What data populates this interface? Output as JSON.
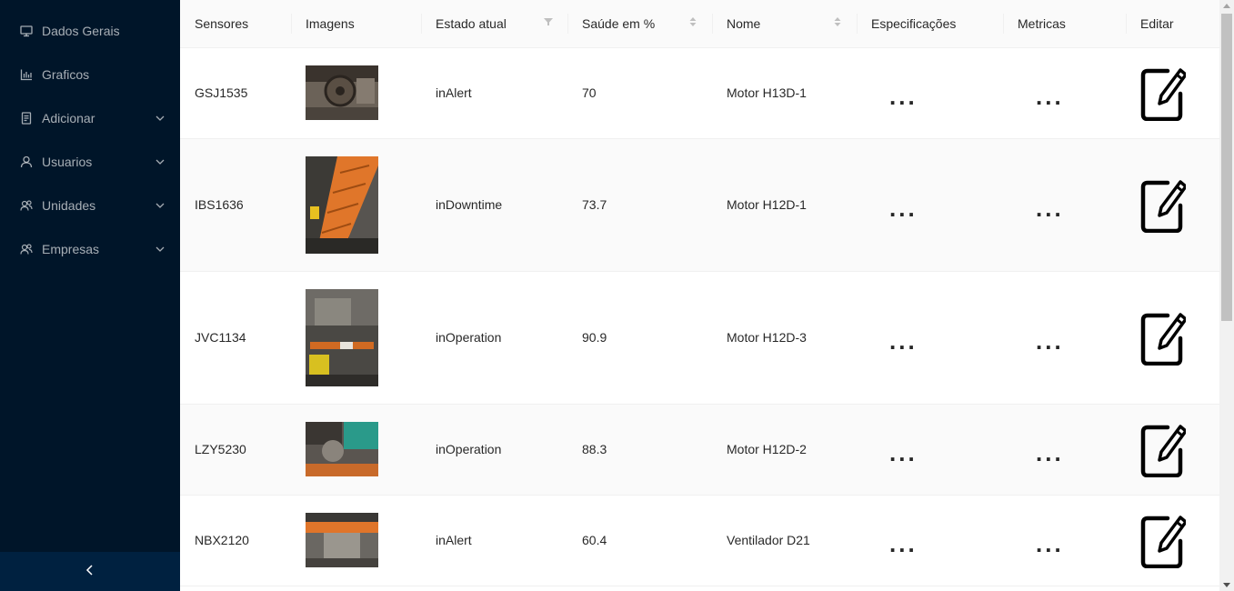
{
  "sidebar": {
    "items": [
      {
        "label": "Dados Gerais",
        "icon": "desktop-icon",
        "submenu": false
      },
      {
        "label": "Graficos",
        "icon": "bar-chart-icon",
        "submenu": false
      },
      {
        "label": "Adicionar",
        "icon": "file-icon",
        "submenu": true
      },
      {
        "label": "Usuarios",
        "icon": "user-icon",
        "submenu": true
      },
      {
        "label": "Unidades",
        "icon": "team-icon",
        "submenu": true
      },
      {
        "label": "Empresas",
        "icon": "team-icon",
        "submenu": true
      }
    ],
    "collapse_icon": "chevron-left-icon"
  },
  "table": {
    "columns": [
      "Sensores",
      "Imagens",
      "Estado atual",
      "Saúde em %",
      "Nome",
      "Especificações",
      "Metricas",
      "Editar"
    ],
    "more_label": "...",
    "rows": [
      {
        "sensor": "GSJ1535",
        "state": "inAlert",
        "health": "70",
        "name": "Motor H13D-1"
      },
      {
        "sensor": "IBS1636",
        "state": "inDowntime",
        "health": "73.7",
        "name": "Motor H12D-1"
      },
      {
        "sensor": "JVC1134",
        "state": "inOperation",
        "health": "90.9",
        "name": "Motor H12D-3"
      },
      {
        "sensor": "LZY5230",
        "state": "inOperation",
        "health": "88.3",
        "name": "Motor H12D-2"
      },
      {
        "sensor": "NBX2120",
        "state": "inAlert",
        "health": "60.4",
        "name": "Ventilador D21"
      }
    ]
  },
  "colors": {
    "sidebar_bg": "#001529",
    "sidebar_footer_bg": "#002140",
    "header_bg": "#fafafa"
  }
}
